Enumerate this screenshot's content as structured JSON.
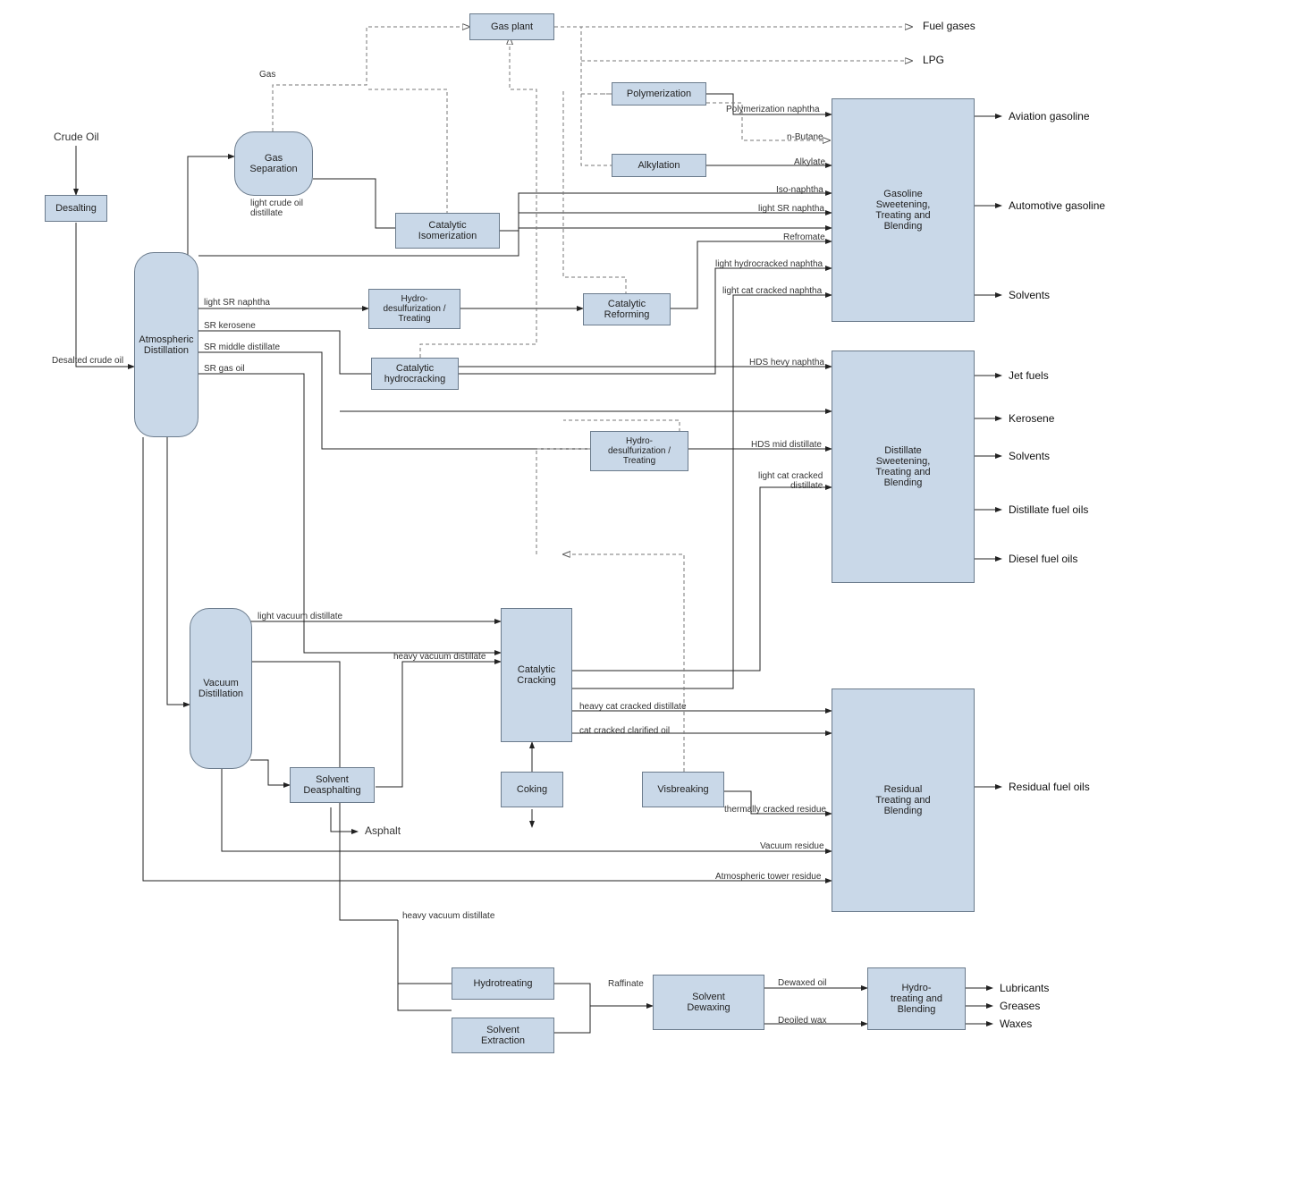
{
  "inputs": {
    "crude": "Crude Oil"
  },
  "nodes": {
    "desalting": "Desalting",
    "gasPlant": "Gas plant",
    "gasSep": "Gas\nSeparation",
    "polymerization": "Polymerization",
    "alkylation": "Alkylation",
    "catIso": "Catalytic\nIsomerization",
    "atmDist": "Atmospheric\nDistillation",
    "hds1": "Hydro-\ndesulfurization /\nTreating",
    "catReform": "Catalytic\nReforming",
    "catHydro": "Catalytic\nhydrocracking",
    "hds2": "Hydro-\ndesulfurization /\nTreating",
    "vacDist": "Vacuum\nDistillation",
    "solvDeasph": "Solvent\nDeasphalting",
    "catCrack": "Catalytic\nCracking",
    "coking": "Coking",
    "visbreak": "Visbreaking",
    "hydrotreat": "Hydrotreating",
    "solvExtract": "Solvent\nExtraction",
    "solvDewax": "Solvent\nDewaxing",
    "hydroBlend": "Hydro-\ntreating and\nBlending",
    "gasBlend": "Gasoline\nSweetening,\nTreating and\nBlending",
    "distBlend": "Distillate\nSweetening,\nTreating and\nBlending",
    "residBlend": "Residual\nTreating and\nBlending"
  },
  "streams": {
    "gas": "Gas",
    "lcod": "light crude oil\ndistillate",
    "desalted": "Desalted crude oil",
    "polyNaph": "Polymerization naphtha",
    "nButane": "n-Butane",
    "alkylate": "Alkylate",
    "isoNaph": "Iso-naphtha",
    "lightSRn": "light SR naphtha",
    "lightSRnaphtha": "light SR naphtha",
    "srKero": "SR kerosene",
    "srMid": "SR middle distillate",
    "srGas": "SR gas oil",
    "refromate": "Refromate",
    "lhcNaph": "light hydrocracked naphtha",
    "lccNaph": "light cat cracked naphtha",
    "hdsHevy": "HDS hevy naphtha",
    "hdsMid": "HDS mid distillate",
    "lccDist": "light cat cracked\ndistillate",
    "lvd": "light vacuum distillate",
    "hvd": "heavy vacuum distillate",
    "hccd": "heavy cat cracked distillate",
    "ccco": "cat cracked clarified oil",
    "asphalt": "Asphalt",
    "tcr": "thermally cracked residue",
    "vacRes": "Vacuum residue",
    "atmRes": "Atmospheric tower residue",
    "hvd2": "heavy vacuum distillate",
    "raffinate": "Raffinate",
    "dewaxed": "Dewaxed oil",
    "deoiled": "Deoiled wax"
  },
  "outputs": {
    "fuelGases": "Fuel gases",
    "lpg": "LPG",
    "avGas": "Aviation gasoline",
    "autoGas": "Automotive gasoline",
    "solvents1": "Solvents",
    "jet": "Jet fuels",
    "kero": "Kerosene",
    "solvents2": "Solvents",
    "distFuel": "Distillate fuel oils",
    "diesel": "Diesel fuel oils",
    "residFuel": "Residual fuel oils",
    "lubes": "Lubricants",
    "greases": "Greases",
    "waxes": "Waxes"
  }
}
